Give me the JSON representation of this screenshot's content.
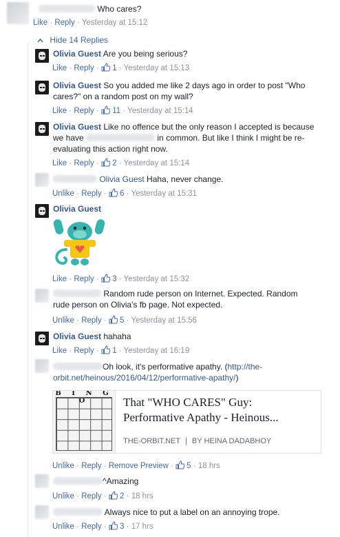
{
  "top_comment": {
    "text": "Who cares?",
    "like": "Like",
    "reply": "Reply",
    "time": "Yesterday at 15:12"
  },
  "hide_replies": "Hide 14 Replies",
  "replies": [
    {
      "author": "Olivia Guest",
      "text": "Are you being serious?",
      "like": "Like",
      "reply": "Reply",
      "count": "1",
      "time": "Yesterday at 15:13"
    },
    {
      "author": "Olivia Guest",
      "text": "So you added me like 2 days ago in order to post \"Who cares?\" on a random post on my wall?",
      "like": "Like",
      "reply": "Reply",
      "count": "11",
      "time": "Yesterday at 15:14"
    },
    {
      "author": "Olivia Guest",
      "text_a": "Like no offence but the only reason I accepted is because we have",
      "text_b": "in common. But like I think I might be re-evaluating this action right now.",
      "like": "Like",
      "reply": "Reply",
      "count": "2",
      "time": "Yesterday at 15:14"
    },
    {
      "mention": "Olivia Guest",
      "text": "Haha, never change.",
      "like": "Unlike",
      "reply": "Reply",
      "count": "6",
      "time": "Yesterday at 15:31"
    },
    {
      "author": "Olivia Guest",
      "like": "Like",
      "reply": "Reply",
      "count": "3",
      "time": "Yesterday at 15:32"
    },
    {
      "text": "Random rude person on Internet. Expected. Random rude person on Olivia's fb page. Not expected.",
      "like": "Unlike",
      "reply": "Reply",
      "count": "5",
      "time": "Yesterday at 15:56"
    },
    {
      "author": "Olivia Guest",
      "text": "hahaha",
      "like": "Like",
      "reply": "Reply",
      "count": "1",
      "time": "Yesterday at 16:19"
    },
    {
      "text": "Oh look, it's performative apathy. (",
      "link": "http://the-orbit.net/heinous/2016/04/12/performative-apathy/",
      "text_end": ")",
      "like": "Unlike",
      "reply": "Reply",
      "remove_preview": "Remove Preview",
      "count": "5",
      "time": "18 hrs"
    },
    {
      "text": "^Amazing",
      "like": "Unlike",
      "reply": "Reply",
      "count": "2",
      "time": "18 hrs"
    },
    {
      "text": "Always nice to put a label on an annoying trope.",
      "like": "Unlike",
      "reply": "Reply",
      "count": "3",
      "time": "17 hrs"
    }
  ],
  "link_preview": {
    "image_text": "B I N G O",
    "title": "That \"WHO CARES\" Guy: Performative Apathy - Heinous...",
    "site": "THE-ORBIT.NET",
    "divider": "|",
    "byline": "BY HEINA DADABHOY"
  },
  "colors": {
    "link": "#4267b2",
    "name": "#365899",
    "meta": "#90949c"
  }
}
